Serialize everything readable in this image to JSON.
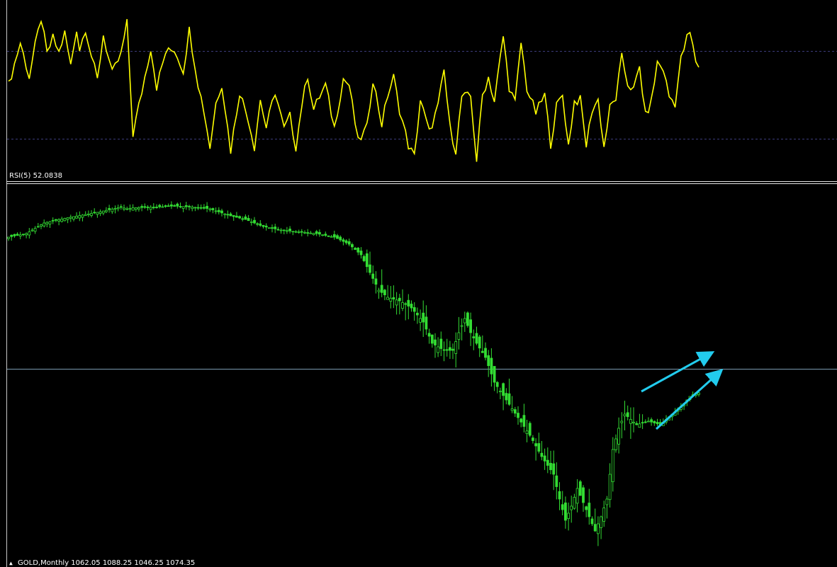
{
  "colors": {
    "background": "#000000",
    "rsi_line": "#ffff00",
    "candles": "#33dd33",
    "levels": "#3c3c7a",
    "frame": "#e6e6e6",
    "price_line": "#7a9bb0",
    "arrows": "#22ccee"
  },
  "rsi": {
    "label": "RSI(5) 52.0838",
    "level_labels": [
      70,
      30
    ],
    "ylim": [
      0,
      100
    ]
  },
  "price": {
    "info": "GOLD,Monthly  1062.05 1088.25 1046.25 1074.35",
    "ylim": [
      0,
      100
    ],
    "trend_arrows": 2
  },
  "chart_data": [
    {
      "type": "line",
      "title": "RSI(5) 52.0838",
      "levels": [
        70,
        30
      ],
      "ylim": [
        0,
        100
      ],
      "x_count": 234,
      "anchors": [
        [
          0,
          52
        ],
        [
          4,
          78
        ],
        [
          7,
          57
        ],
        [
          9,
          76
        ],
        [
          11,
          93
        ],
        [
          13,
          71
        ],
        [
          15,
          81
        ],
        [
          17,
          72
        ],
        [
          19,
          84
        ],
        [
          21,
          64
        ],
        [
          23,
          87
        ],
        [
          24,
          74
        ],
        [
          26,
          87
        ],
        [
          28,
          70
        ],
        [
          30,
          55
        ],
        [
          32,
          83
        ],
        [
          35,
          59
        ],
        [
          38,
          71
        ],
        [
          40,
          90
        ],
        [
          42,
          22
        ],
        [
          45,
          48
        ],
        [
          48,
          75
        ],
        [
          50,
          51
        ],
        [
          53,
          72
        ],
        [
          56,
          74
        ],
        [
          59,
          61
        ],
        [
          61,
          86
        ],
        [
          64,
          53
        ],
        [
          66,
          36
        ],
        [
          68,
          14
        ],
        [
          70,
          41
        ],
        [
          72,
          53
        ],
        [
          75,
          12
        ],
        [
          78,
          48
        ],
        [
          81,
          31
        ],
        [
          83,
          14
        ],
        [
          85,
          43
        ],
        [
          87,
          26
        ],
        [
          90,
          48
        ],
        [
          93,
          25
        ],
        [
          95,
          33
        ],
        [
          97,
          14
        ],
        [
          99,
          40
        ],
        [
          101,
          58
        ],
        [
          103,
          37
        ],
        [
          105,
          45
        ],
        [
          107,
          52
        ],
        [
          110,
          26
        ],
        [
          113,
          56
        ],
        [
          115,
          52
        ],
        [
          118,
          17
        ],
        [
          121,
          26
        ],
        [
          123,
          56
        ],
        [
          126,
          28
        ],
        [
          128,
          46
        ],
        [
          130,
          57
        ],
        [
          132,
          37
        ],
        [
          135,
          15
        ],
        [
          137,
          8
        ],
        [
          139,
          43
        ],
        [
          142,
          23
        ],
        [
          145,
          39
        ],
        [
          147,
          61
        ],
        [
          149,
          26
        ],
        [
          151,
          12
        ],
        [
          153,
          45
        ],
        [
          156,
          45
        ],
        [
          158,
          6
        ],
        [
          160,
          46
        ],
        [
          162,
          57
        ],
        [
          164,
          42
        ],
        [
          167,
          82
        ],
        [
          169,
          51
        ],
        [
          171,
          41
        ],
        [
          173,
          78
        ],
        [
          175,
          50
        ],
        [
          178,
          35
        ],
        [
          181,
          46
        ],
        [
          183,
          16
        ],
        [
          185,
          39
        ],
        [
          187,
          46
        ],
        [
          189,
          15
        ],
        [
          191,
          42
        ],
        [
          193,
          43
        ],
        [
          195,
          15
        ],
        [
          197,
          37
        ],
        [
          199,
          43
        ],
        [
          201,
          14
        ],
        [
          203,
          38
        ],
        [
          205,
          44
        ],
        [
          207,
          69
        ],
        [
          209,
          53
        ],
        [
          211,
          49
        ],
        [
          213,
          63
        ],
        [
          215,
          33
        ],
        [
          217,
          42
        ],
        [
          219,
          66
        ],
        [
          221,
          62
        ],
        [
          223,
          45
        ],
        [
          225,
          41
        ],
        [
          227,
          68
        ],
        [
          229,
          81
        ],
        [
          230,
          84
        ],
        [
          232,
          67
        ],
        [
          234,
          61
        ]
      ]
    },
    {
      "type": "candlestick",
      "title": "GOLD,Monthly",
      "last_bar": {
        "open": 1062.05,
        "high": 1088.25,
        "low": 1046.25,
        "close": 1074.35
      },
      "ylim": [
        0,
        100
      ],
      "x_count": 234,
      "anchors": [
        [
          0,
          87
        ],
        [
          6,
          88
        ],
        [
          12,
          91
        ],
        [
          20,
          92.5
        ],
        [
          30,
          94
        ],
        [
          38,
          95.5
        ],
        [
          40,
          95
        ],
        [
          42,
          95.3
        ],
        [
          50,
          95.5
        ],
        [
          56,
          95.8
        ],
        [
          62,
          95.5
        ],
        [
          68,
          95
        ],
        [
          75,
          93
        ],
        [
          80,
          92
        ],
        [
          86,
          90
        ],
        [
          92,
          89
        ],
        [
          98,
          88.5
        ],
        [
          104,
          88
        ],
        [
          110,
          87
        ],
        [
          115,
          85
        ],
        [
          119,
          82
        ],
        [
          122,
          77
        ],
        [
          125,
          72
        ],
        [
          128,
          70
        ],
        [
          132,
          69
        ],
        [
          136,
          67
        ],
        [
          140,
          63
        ],
        [
          143,
          57
        ],
        [
          147,
          55
        ],
        [
          150,
          55
        ],
        [
          152,
          60
        ],
        [
          154,
          64
        ],
        [
          156,
          60
        ],
        [
          158,
          57
        ],
        [
          161,
          53
        ],
        [
          164,
          46
        ],
        [
          168,
          41
        ],
        [
          172,
          36
        ],
        [
          176,
          31
        ],
        [
          180,
          25
        ],
        [
          184,
          20
        ],
        [
          186,
          13
        ],
        [
          188,
          7
        ],
        [
          190,
          11
        ],
        [
          192,
          16
        ],
        [
          194,
          12
        ],
        [
          196,
          8
        ],
        [
          198,
          4
        ],
        [
          200,
          8
        ],
        [
          202,
          13
        ],
        [
          204,
          27
        ],
        [
          206,
          33
        ],
        [
          208,
          37
        ],
        [
          212,
          34
        ],
        [
          216,
          35
        ],
        [
          220,
          34
        ],
        [
          224,
          37
        ],
        [
          228,
          40
        ],
        [
          230,
          42
        ],
        [
          232,
          43
        ],
        [
          234,
          43
        ]
      ]
    }
  ]
}
